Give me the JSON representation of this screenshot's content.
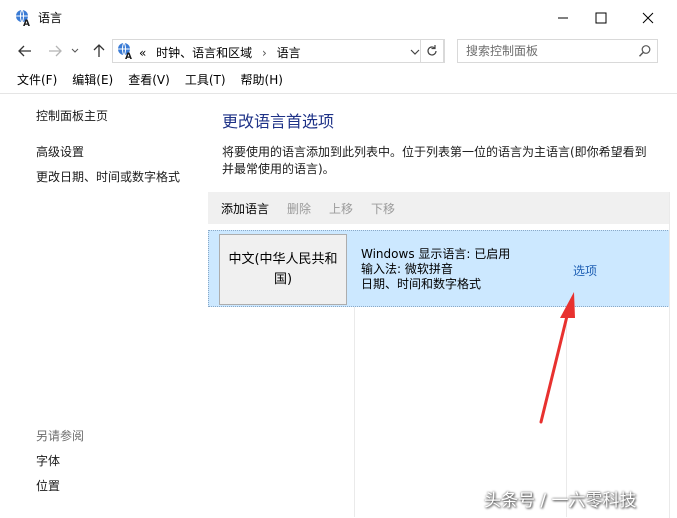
{
  "window": {
    "title": "语言"
  },
  "address": {
    "chevrons": "«",
    "crumbs": [
      "时钟、语言和区域",
      "语言"
    ],
    "sep": "›"
  },
  "search": {
    "placeholder": "搜索控制面板"
  },
  "menu": [
    "文件(F)",
    "编辑(E)",
    "查看(V)",
    "工具(T)",
    "帮助(H)"
  ],
  "left": {
    "home": "控制面板主页",
    "advanced": "高级设置",
    "change_date": "更改日期、时间或数字格式",
    "see_also": "另请参阅",
    "fonts": "字体",
    "location": "位置"
  },
  "main": {
    "title": "更改语言首选项",
    "desc_line1": "将要使用的语言添加到此列表中。位于列表第一位的语言为主语言(即你希望看到",
    "desc_line2": "并最常使用的语言)。",
    "toolbar": {
      "add": "添加语言",
      "remove": "删除",
      "up": "上移",
      "down": "下移"
    },
    "language": {
      "name": "中文(中华人民共和国)",
      "display": "Windows 显示语言: 已启用",
      "ime": "输入法: 微软拼音",
      "format": "日期、时间和数字格式",
      "options": "选项"
    }
  },
  "watermark": "头条号 / 一六零科技",
  "colors": {
    "title_blue": "#1e3287",
    "link_blue": "#1e5fb4",
    "selection": "#cce8ff",
    "arrow": "#e8312f"
  }
}
